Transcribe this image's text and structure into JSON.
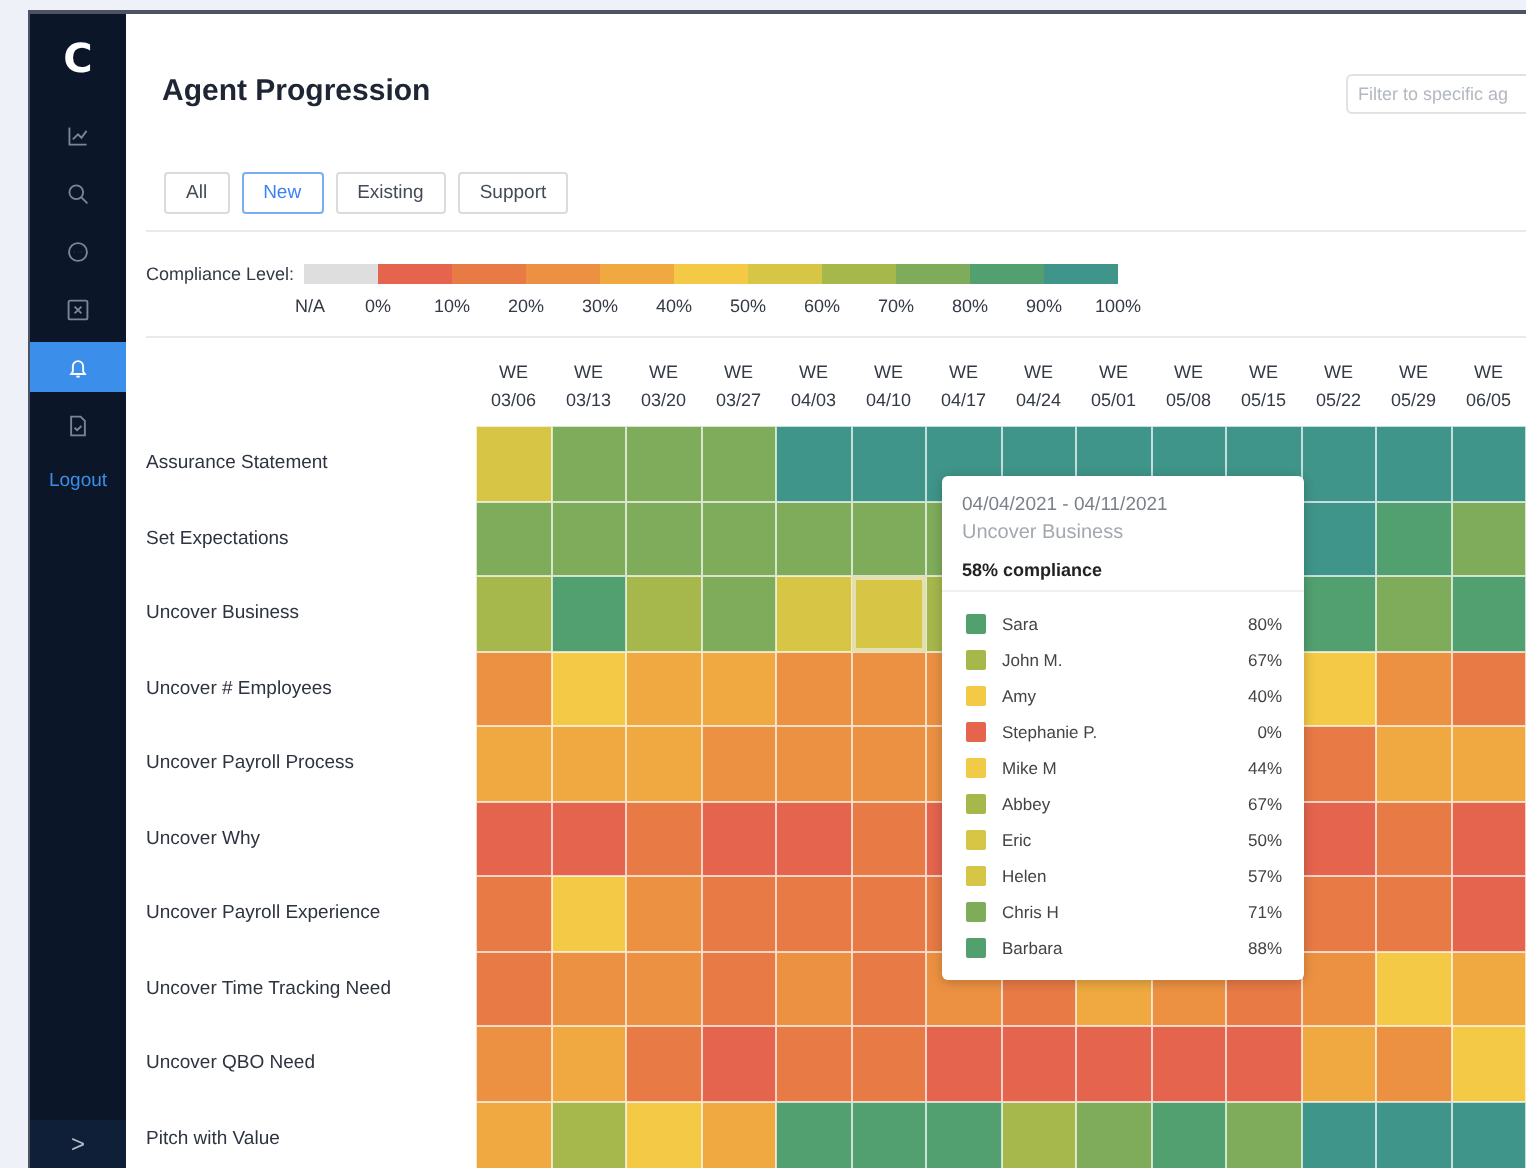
{
  "sidebar": {
    "logo": "C",
    "items": [
      {
        "kind": "chart",
        "selected": false
      },
      {
        "kind": "search",
        "selected": false
      },
      {
        "kind": "chat",
        "selected": false
      },
      {
        "kind": "close",
        "selected": false
      },
      {
        "kind": "bell",
        "selected": true
      },
      {
        "kind": "document",
        "selected": false
      }
    ],
    "logout": "Logout",
    "expand": ">"
  },
  "header": {
    "title": "Agent Progression",
    "filter": {
      "placeholder": "Filter to specific ag"
    }
  },
  "tabs": [
    {
      "label": "All",
      "selected": false
    },
    {
      "label": "New",
      "selected": true
    },
    {
      "label": "Existing",
      "selected": false
    },
    {
      "label": "Support",
      "selected": false
    }
  ],
  "legend": {
    "label": "Compliance Level:",
    "segments": [
      {
        "color": "#dedede"
      },
      {
        "color": "#e5644e"
      },
      {
        "color": "#e87a45"
      },
      {
        "color": "#ec9142"
      },
      {
        "color": "#efa940"
      },
      {
        "color": "#f3c945"
      },
      {
        "color": "#d7c645"
      },
      {
        "color": "#a6b84c"
      },
      {
        "color": "#7fac5b"
      },
      {
        "color": "#52a070"
      },
      {
        "color": "#3f9589"
      }
    ],
    "ticks": [
      "N/A",
      "0%",
      "10%",
      "20%",
      "30%",
      "40%",
      "50%",
      "60%",
      "70%",
      "80%",
      "90%",
      "100%"
    ]
  },
  "heatmap": {
    "columns": [
      {
        "week": "WE",
        "date": "03/06"
      },
      {
        "week": "WE",
        "date": "03/13"
      },
      {
        "week": "WE",
        "date": "03/20"
      },
      {
        "week": "WE",
        "date": "03/27"
      },
      {
        "week": "WE",
        "date": "04/03"
      },
      {
        "week": "WE",
        "date": "04/10"
      },
      {
        "week": "WE",
        "date": "04/17"
      },
      {
        "week": "WE",
        "date": "04/24"
      },
      {
        "week": "WE",
        "date": "05/01"
      },
      {
        "week": "WE",
        "date": "05/08"
      },
      {
        "week": "WE",
        "date": "05/15"
      },
      {
        "week": "WE",
        "date": "05/22"
      },
      {
        "week": "WE",
        "date": "05/29"
      },
      {
        "week": "WE",
        "date": "06/05"
      }
    ],
    "rows": [
      {
        "label": "Assurance Statement",
        "cells": [
          {
            "color": "#d7c645",
            "selected": false
          },
          {
            "color": "#7fac5b",
            "selected": false
          },
          {
            "color": "#7fac5b",
            "selected": false
          },
          {
            "color": "#7fac5b",
            "selected": false
          },
          {
            "color": "#3f9589",
            "selected": false
          },
          {
            "color": "#3f9589",
            "selected": false
          },
          {
            "color": "#3f9589",
            "selected": false
          },
          {
            "color": "#3f9589",
            "selected": false
          },
          {
            "color": "#3f9589",
            "selected": false
          },
          {
            "color": "#3f9589",
            "selected": false
          },
          {
            "color": "#3f9589",
            "selected": false
          },
          {
            "color": "#3f9589",
            "selected": false
          },
          {
            "color": "#3f9589",
            "selected": false
          },
          {
            "color": "#3f9589",
            "selected": false
          }
        ]
      },
      {
        "label": "Set Expectations",
        "cells": [
          {
            "color": "#7fac5b",
            "selected": false
          },
          {
            "color": "#7fac5b",
            "selected": false
          },
          {
            "color": "#7fac5b",
            "selected": false
          },
          {
            "color": "#7fac5b",
            "selected": false
          },
          {
            "color": "#7fac5b",
            "selected": false
          },
          {
            "color": "#7fac5b",
            "selected": false
          },
          {
            "color": "#7fac5b",
            "selected": false
          },
          null,
          null,
          null,
          null,
          {
            "color": "#3f9589",
            "selected": false
          },
          {
            "color": "#52a070",
            "selected": false
          },
          {
            "color": "#7fac5b",
            "selected": false
          }
        ]
      },
      {
        "label": "Uncover Business",
        "cells": [
          {
            "color": "#a6b84c",
            "selected": false
          },
          {
            "color": "#52a070",
            "selected": false
          },
          {
            "color": "#a6b84c",
            "selected": false
          },
          {
            "color": "#7fac5b",
            "selected": false
          },
          {
            "color": "#d7c645",
            "selected": false
          },
          {
            "color": "#d7c645",
            "selected": true
          },
          {
            "color": "#a6b84c",
            "selected": false
          },
          null,
          null,
          null,
          null,
          {
            "color": "#52a070",
            "selected": false
          },
          {
            "color": "#7fac5b",
            "selected": false
          },
          {
            "color": "#52a070",
            "selected": false
          }
        ]
      },
      {
        "label": "Uncover # Employees",
        "cells": [
          {
            "color": "#ec9142",
            "selected": false
          },
          {
            "color": "#f3c945",
            "selected": false
          },
          {
            "color": "#efa940",
            "selected": false
          },
          {
            "color": "#efa940",
            "selected": false
          },
          {
            "color": "#ec9142",
            "selected": false
          },
          {
            "color": "#ec9142",
            "selected": false
          },
          {
            "color": "#ec9142",
            "selected": false
          },
          null,
          null,
          null,
          null,
          {
            "color": "#f3c945",
            "selected": false
          },
          {
            "color": "#ec9142",
            "selected": false
          },
          {
            "color": "#e87a45",
            "selected": false
          }
        ]
      },
      {
        "label": "Uncover Payroll Process",
        "cells": [
          {
            "color": "#efa940",
            "selected": false
          },
          {
            "color": "#efa940",
            "selected": false
          },
          {
            "color": "#efa940",
            "selected": false
          },
          {
            "color": "#ec9142",
            "selected": false
          },
          {
            "color": "#ec9142",
            "selected": false
          },
          {
            "color": "#ec9142",
            "selected": false
          },
          {
            "color": "#ec9142",
            "selected": false
          },
          null,
          null,
          null,
          null,
          {
            "color": "#e87a45",
            "selected": false
          },
          {
            "color": "#efa940",
            "selected": false
          },
          {
            "color": "#efa940",
            "selected": false
          }
        ]
      },
      {
        "label": "Uncover Why",
        "cells": [
          {
            "color": "#e5644e",
            "selected": false
          },
          {
            "color": "#e5644e",
            "selected": false
          },
          {
            "color": "#e87a45",
            "selected": false
          },
          {
            "color": "#e5644e",
            "selected": false
          },
          {
            "color": "#e5644e",
            "selected": false
          },
          {
            "color": "#e87a45",
            "selected": false
          },
          {
            "color": "#e5644e",
            "selected": false
          },
          null,
          null,
          null,
          null,
          {
            "color": "#e5644e",
            "selected": false
          },
          {
            "color": "#e87a45",
            "selected": false
          },
          {
            "color": "#e5644e",
            "selected": false
          }
        ]
      },
      {
        "label": "Uncover Payroll Experience",
        "cells": [
          {
            "color": "#e87a45",
            "selected": false
          },
          {
            "color": "#f3c945",
            "selected": false
          },
          {
            "color": "#ec9142",
            "selected": false
          },
          {
            "color": "#e87a45",
            "selected": false
          },
          {
            "color": "#e87a45",
            "selected": false
          },
          {
            "color": "#e87a45",
            "selected": false
          },
          {
            "color": "#e87a45",
            "selected": false
          },
          null,
          null,
          null,
          null,
          {
            "color": "#e87a45",
            "selected": false
          },
          {
            "color": "#e87a45",
            "selected": false
          },
          {
            "color": "#e5644e",
            "selected": false
          }
        ]
      },
      {
        "label": "Uncover Time Tracking Need",
        "cells": [
          {
            "color": "#e87a45",
            "selected": false
          },
          {
            "color": "#ec9142",
            "selected": false
          },
          {
            "color": "#ec9142",
            "selected": false
          },
          {
            "color": "#e87a45",
            "selected": false
          },
          {
            "color": "#ec9142",
            "selected": false
          },
          {
            "color": "#e87a45",
            "selected": false
          },
          {
            "color": "#ec9142",
            "selected": false
          },
          {
            "color": "#e87a45",
            "selected": false
          },
          {
            "color": "#efa940",
            "selected": false
          },
          {
            "color": "#ec9142",
            "selected": false
          },
          {
            "color": "#e87a45",
            "selected": false
          },
          {
            "color": "#ec9142",
            "selected": false
          },
          {
            "color": "#f3c945",
            "selected": false
          },
          {
            "color": "#efa940",
            "selected": false
          }
        ]
      },
      {
        "label": "Uncover QBO Need",
        "cells": [
          {
            "color": "#ec9142",
            "selected": false
          },
          {
            "color": "#efa940",
            "selected": false
          },
          {
            "color": "#e87a45",
            "selected": false
          },
          {
            "color": "#e5644e",
            "selected": false
          },
          {
            "color": "#e87a45",
            "selected": false
          },
          {
            "color": "#e87a45",
            "selected": false
          },
          {
            "color": "#e5644e",
            "selected": false
          },
          {
            "color": "#e5644e",
            "selected": false
          },
          {
            "color": "#e5644e",
            "selected": false
          },
          {
            "color": "#e5644e",
            "selected": false
          },
          {
            "color": "#e5644e",
            "selected": false
          },
          {
            "color": "#efa940",
            "selected": false
          },
          {
            "color": "#ec9142",
            "selected": false
          },
          {
            "color": "#f3c945",
            "selected": false
          }
        ]
      },
      {
        "label": "Pitch with Value",
        "cells": [
          {
            "color": "#efa940",
            "selected": false
          },
          {
            "color": "#a6b84c",
            "selected": false
          },
          {
            "color": "#f3c945",
            "selected": false
          },
          {
            "color": "#efa940",
            "selected": false
          },
          {
            "color": "#52a070",
            "selected": false
          },
          {
            "color": "#52a070",
            "selected": false
          },
          {
            "color": "#52a070",
            "selected": false
          },
          {
            "color": "#a6b84c",
            "selected": false
          },
          {
            "color": "#7fac5b",
            "selected": false
          },
          {
            "color": "#52a070",
            "selected": false
          },
          {
            "color": "#7fac5b",
            "selected": false
          },
          {
            "color": "#3f9589",
            "selected": false
          },
          {
            "color": "#3f9589",
            "selected": false
          },
          {
            "color": "#3f9589",
            "selected": false
          }
        ]
      }
    ],
    "tooltip": {
      "range": "04/04/2021 - 04/11/2021",
      "step": "Uncover Business",
      "compliance": "58% compliance",
      "agents": [
        {
          "name": "Sara",
          "value": "80%",
          "color": "#52a070"
        },
        {
          "name": "John M.",
          "value": "67%",
          "color": "#a6b84c"
        },
        {
          "name": "Amy",
          "value": "40%",
          "color": "#f3c945"
        },
        {
          "name": "Stephanie P.",
          "value": "0%",
          "color": "#e5644e"
        },
        {
          "name": "Mike M",
          "value": "44%",
          "color": "#f3c945"
        },
        {
          "name": "Abbey",
          "value": "67%",
          "color": "#a6b84c"
        },
        {
          "name": "Eric",
          "value": "50%",
          "color": "#d7c645"
        },
        {
          "name": "Helen",
          "value": "57%",
          "color": "#d7c645"
        },
        {
          "name": "Chris H",
          "value": "71%",
          "color": "#7fac5b"
        },
        {
          "name": "Barbara",
          "value": "88%",
          "color": "#52a070"
        }
      ]
    }
  }
}
